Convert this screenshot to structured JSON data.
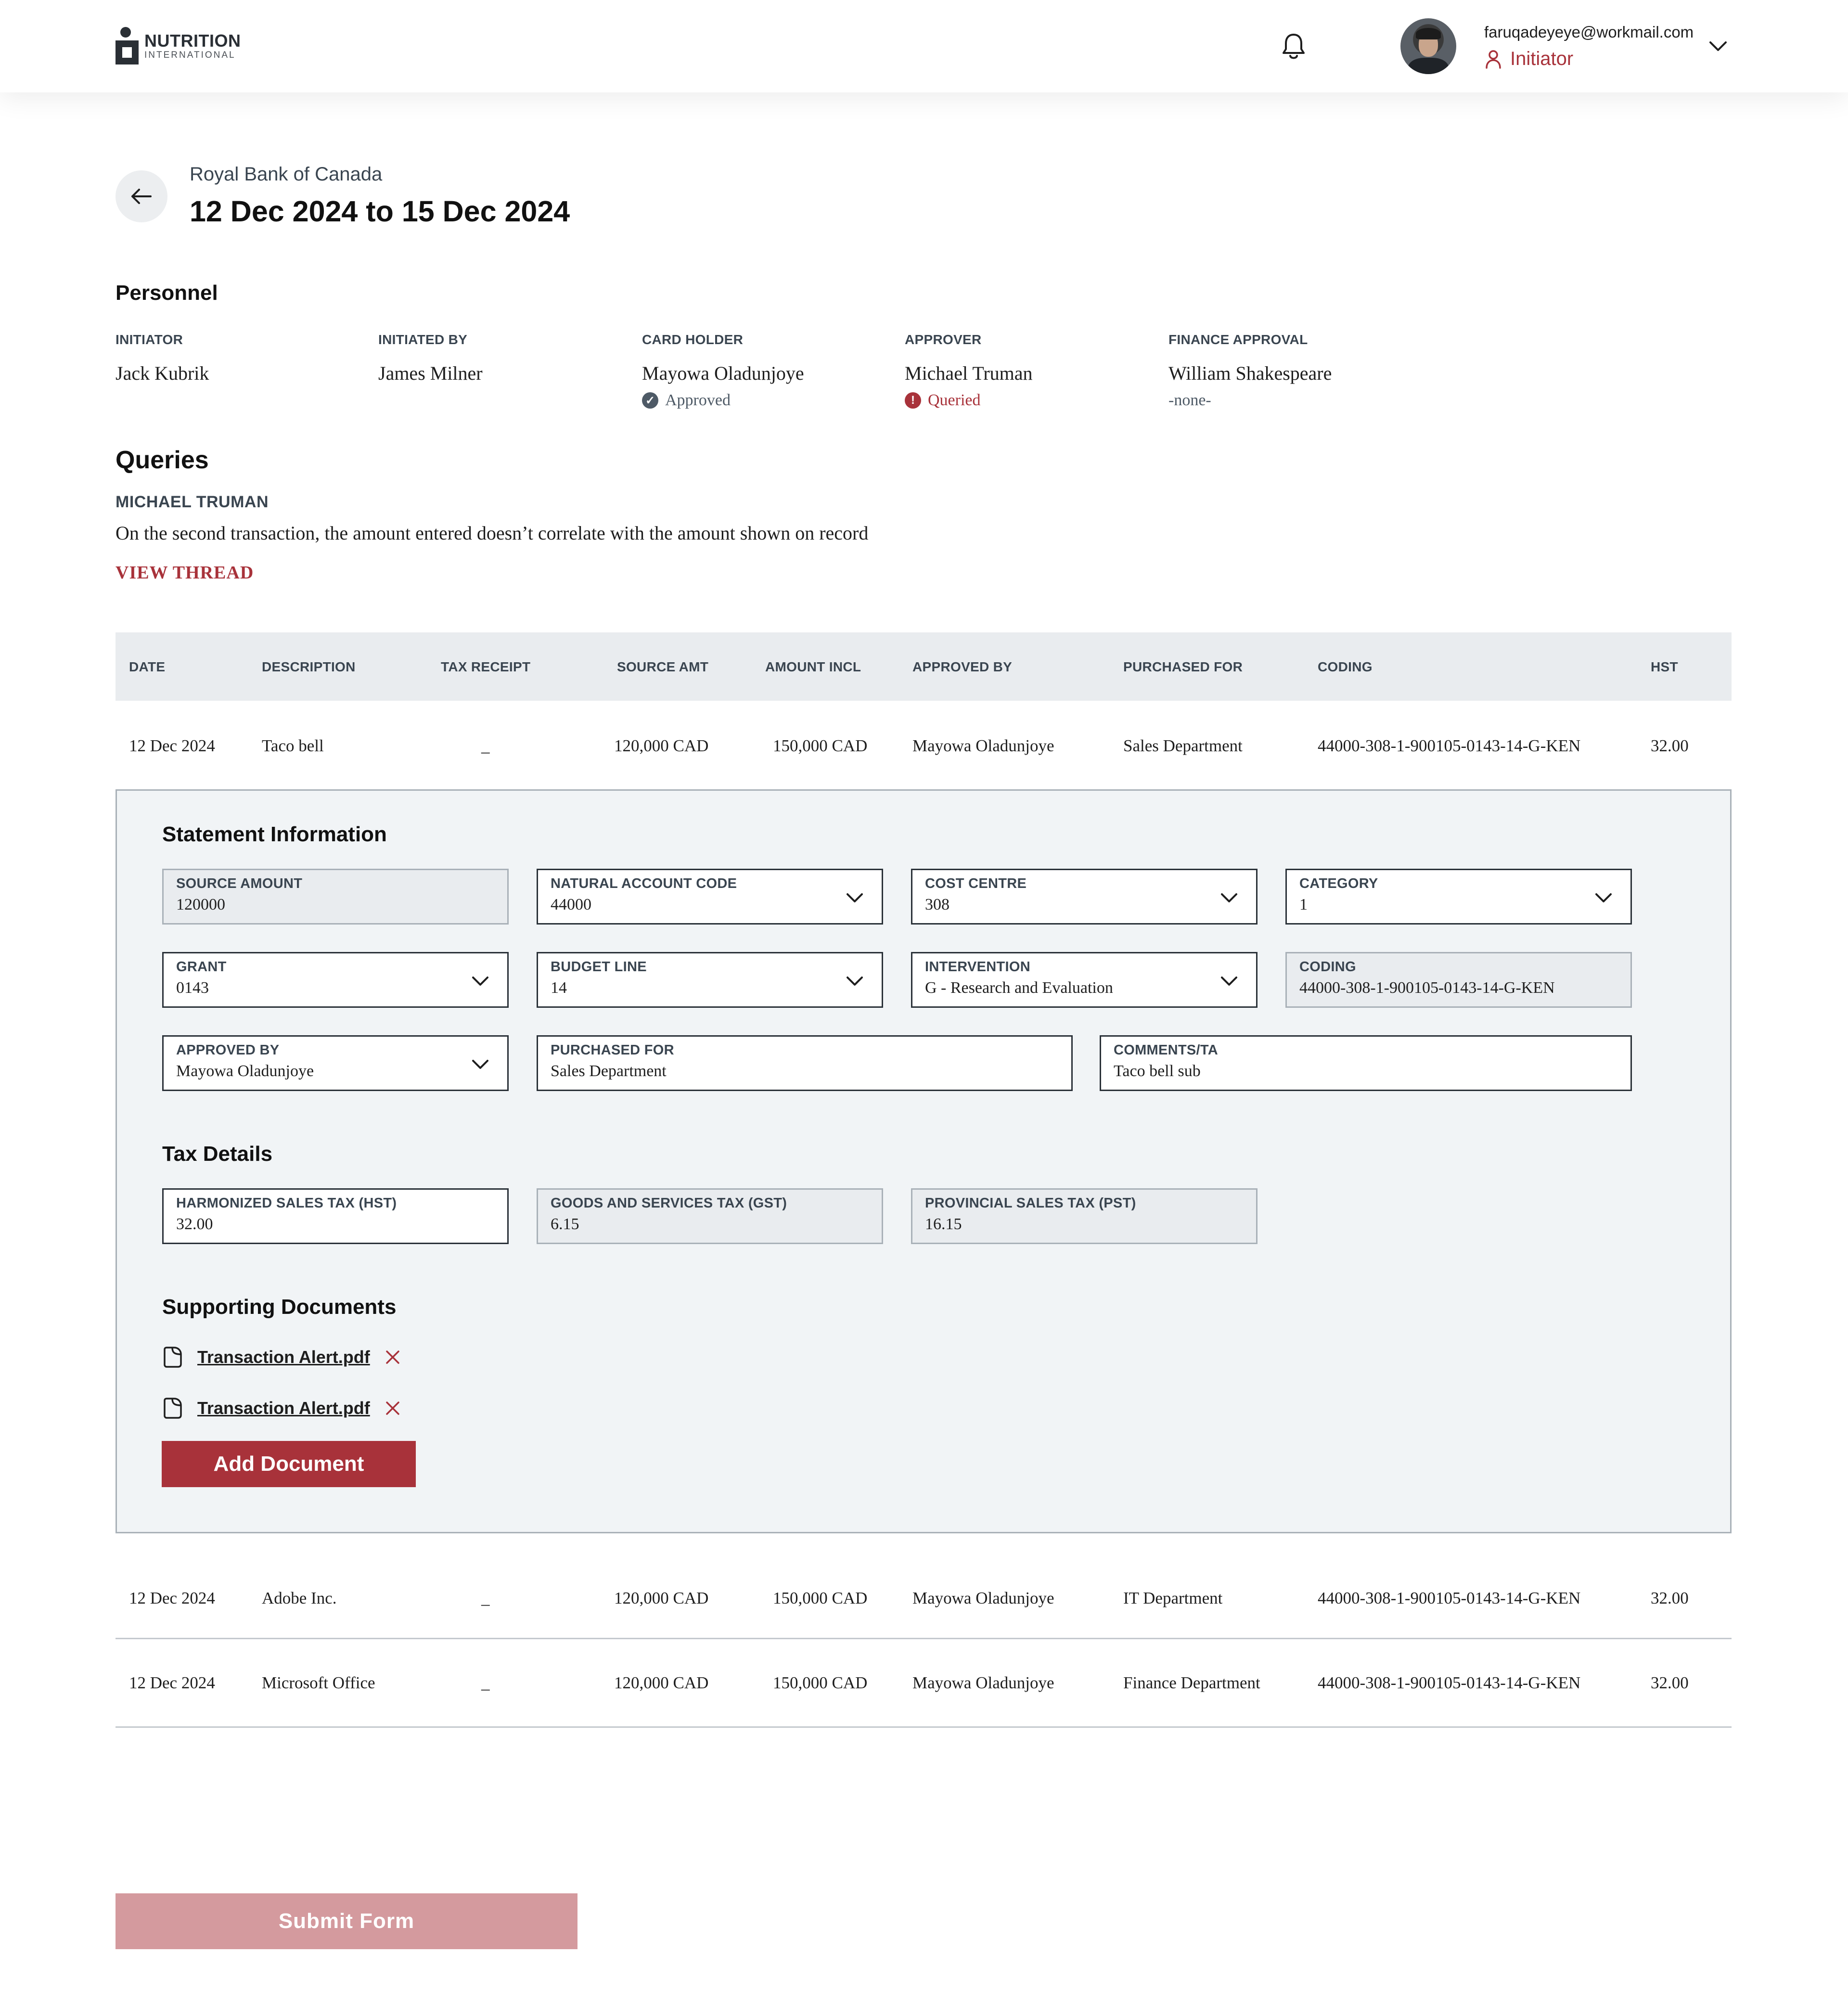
{
  "header": {
    "logo_line1": "NUTRITION",
    "logo_line2": "INTERNATIONAL",
    "user_email": "faruqadeyeye@workmail.com",
    "user_role": "Initiator"
  },
  "page": {
    "bank": "Royal Bank of Canada",
    "date_range": "12 Dec 2024 to 15 Dec 2024"
  },
  "personnel": {
    "title": "Personnel",
    "initiator": {
      "label": "INITIATOR",
      "name": "Jack Kubrik"
    },
    "initiated_by": {
      "label": "INITIATED BY",
      "name": "James Milner"
    },
    "card_holder": {
      "label": "CARD HOLDER",
      "name": "Mayowa Oladunjoye",
      "status": "Approved"
    },
    "approver": {
      "label": "APPROVER",
      "name": "Michael Truman",
      "status": "Queried"
    },
    "finance_approval": {
      "label": "FINANCE APPROVAL",
      "name": "William Shakespeare",
      "status": "-none-"
    }
  },
  "queries": {
    "title": "Queries",
    "author": "MICHAEL TRUMAN",
    "text": "On the second transaction, the amount entered doesn’t correlate with the amount shown on record",
    "link": "VIEW THREAD"
  },
  "table": {
    "headers": [
      "DATE",
      "DESCRIPTION",
      "TAX RECEIPT",
      "SOURCE AMT",
      "AMOUNT INCL",
      "APPROVED BY",
      "PURCHASED FOR",
      "CODING",
      "HST"
    ],
    "rows": [
      [
        "12 Dec 2024",
        "Taco bell",
        "_",
        "120,000 CAD",
        "150,000 CAD",
        "Mayowa Oladunjoye",
        "Sales Department",
        "44000-308-1-900105-0143-14-G-KEN",
        "32.00"
      ],
      [
        "12 Dec 2024",
        "Adobe Inc.",
        "_",
        "120,000 CAD",
        "150,000 CAD",
        "Mayowa Oladunjoye",
        "IT Department",
        "44000-308-1-900105-0143-14-G-KEN",
        "32.00"
      ],
      [
        "12 Dec 2024",
        "Microsoft Office",
        "_",
        "120,000 CAD",
        "150,000 CAD",
        "Mayowa Oladunjoye",
        "Finance Department",
        "44000-308-1-900105-0143-14-G-KEN",
        "32.00"
      ]
    ]
  },
  "statement": {
    "title": "Statement Information",
    "source_amount": {
      "label": "SOURCE AMOUNT",
      "value": "120000"
    },
    "natural_account_code": {
      "label": "NATURAL ACCOUNT CODE",
      "value": "44000"
    },
    "cost_centre": {
      "label": "COST CENTRE",
      "value": "308"
    },
    "category": {
      "label": "CATEGORY",
      "value": "1"
    },
    "grant": {
      "label": "GRANT",
      "value": "0143"
    },
    "budget_line": {
      "label": "BUDGET LINE",
      "value": "14"
    },
    "intervention": {
      "label": "INTERVENTION",
      "value": "G - Research and Evaluation"
    },
    "coding": {
      "label": "CODING",
      "value": "44000-308-1-900105-0143-14-G-KEN"
    },
    "approved_by": {
      "label": "APPROVED BY",
      "value": "Mayowa Oladunjoye"
    },
    "purchased_for": {
      "label": "PURCHASED FOR",
      "value": "Sales Department"
    },
    "comments": {
      "label": "COMMENTS/TA",
      "value": "Taco bell sub"
    }
  },
  "tax": {
    "title": "Tax Details",
    "hst": {
      "label": "HARMONIZED SALES TAX (HST)",
      "value": "32.00"
    },
    "gst": {
      "label": "GOODS AND SERVICES TAX (GST)",
      "value": "6.15"
    },
    "pst": {
      "label": "PROVINCIAL SALES TAX (PST)",
      "value": "16.15"
    }
  },
  "documents": {
    "title": "Supporting Documents",
    "files": [
      "Transaction Alert.pdf",
      "Transaction Alert.pdf"
    ],
    "add_label": "Add Document"
  },
  "submit_label": "Submit Form",
  "colors": {
    "accent": "#a8323a",
    "submit_disabled": "#d49a9e",
    "header_bg": "#e9ecef",
    "panel_bg": "#f1f4f6"
  }
}
